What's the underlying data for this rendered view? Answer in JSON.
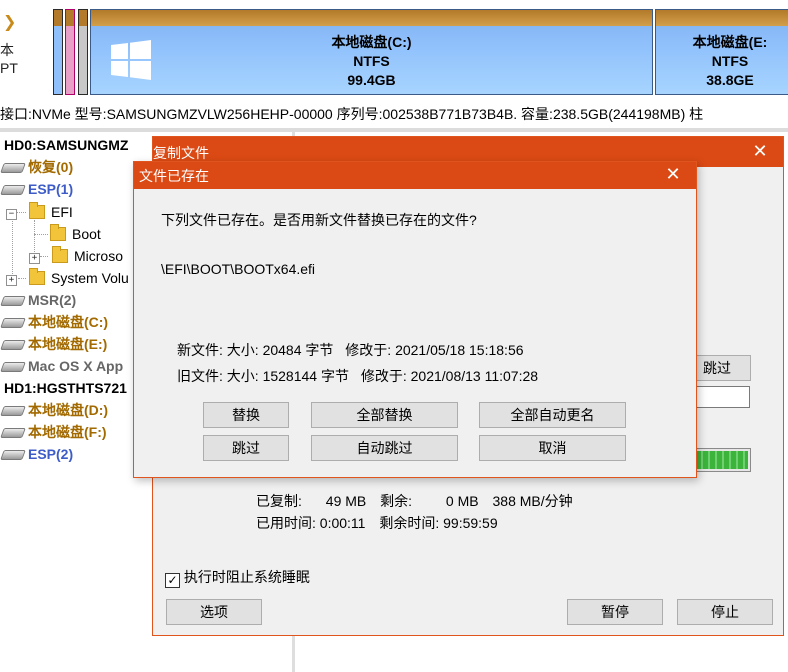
{
  "disk_side": {
    "line1": "本",
    "line2": "PT"
  },
  "partitions": [
    {
      "name": "本地磁盘(C:)",
      "fs": "NTFS",
      "size": "99.4GB"
    },
    {
      "name": "本地磁盘(E:",
      "fs": "NTFS",
      "size": "38.8GE"
    }
  ],
  "info_line": "接口:NVMe  型号:SAMSUNGMZVLW256HEHP-00000  序列号:002538B771B73B4B.  容量:238.5GB(244198MB)  柱",
  "tree": {
    "hd0": "HD0:SAMSUNGMZ",
    "recovery": "恢复(0)",
    "esp1": "ESP(1)",
    "efi": "EFI",
    "boot": "Boot",
    "microsoft": "Microso",
    "system_volume": "System Volu",
    "msr": "MSR(2)",
    "local_c": "本地磁盘(C:)",
    "local_e": "本地磁盘(E:)",
    "macos": "Mac OS X App",
    "hd1": "HD1:HGSTHTS721",
    "local_d": "本地磁盘(D:)",
    "local_f": "本地磁盘(F:)",
    "esp2": "ESP(2)"
  },
  "copy_dialog": {
    "title": "复制文件",
    "close": "✕",
    "skip_label": "跳过",
    "copied_label": "已复制:",
    "copied_value": "49 MB",
    "remaining_label": "剩余:",
    "remaining_value": "0 MB",
    "speed": "388 MB/分钟",
    "elapsed_label": "已用时间:",
    "elapsed_value": "0:00:11",
    "remaining_time_label": "剩余时间:",
    "remaining_time_value": "99:59:59",
    "prevent_sleep_label": "执行时阻止系统睡眠",
    "prevent_sleep_checked": true,
    "options_label": "选项",
    "pause_label": "暂停",
    "stop_label": "停止",
    "progress": 1.0
  },
  "exists_dialog": {
    "title": "文件已存在",
    "close": "✕",
    "question": "下列文件已存在。是否用新文件替换已存在的文件?",
    "path": "\\EFI\\BOOT\\BOOTx64.efi",
    "new_file_label": "新文件:",
    "new_size_label": "大小:",
    "new_size": "20484 字节",
    "new_modified_label": "修改于:",
    "new_modified": "2021/05/18 15:18:56",
    "old_file_label": "旧文件:",
    "old_size_label": "大小:",
    "old_size": "1528144 字节",
    "old_modified_label": "修改于:",
    "old_modified": "2021/08/13 11:07:28",
    "buttons": {
      "replace": "替换",
      "replace_all": "全部替换",
      "auto_rename_all": "全部自动更名",
      "skip": "跳过",
      "auto_skip": "自动跳过",
      "cancel": "取消"
    }
  },
  "colors": {
    "title_bar": "#db4a14",
    "partition_fill": "#8fc0fb",
    "partition_cap": "#c58d3a",
    "tree_orange": "#a26a00",
    "tree_blue": "#3d5cc8",
    "progress_green": "#3cb43c"
  }
}
